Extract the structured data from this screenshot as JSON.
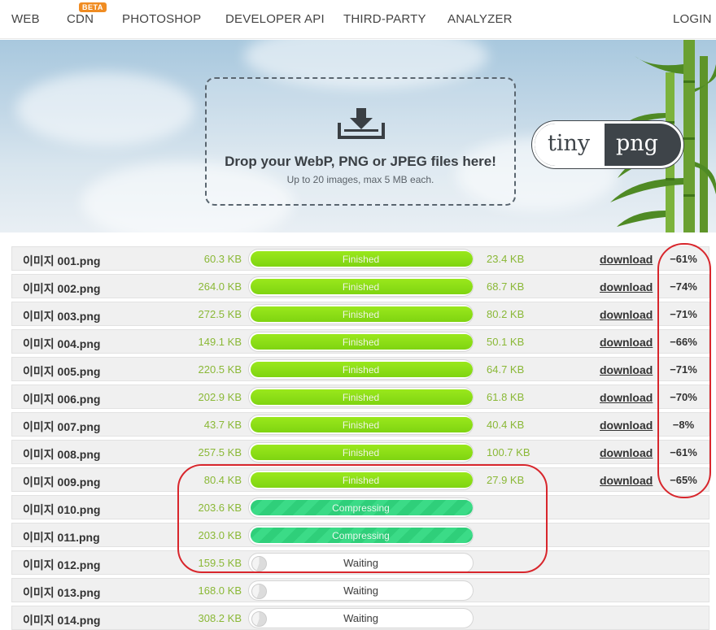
{
  "nav": {
    "items": [
      "WEB",
      "CDN",
      "PHOTOSHOP",
      "DEVELOPER API",
      "THIRD-PARTY",
      "ANALYZER"
    ],
    "beta_badge": "BETA",
    "login": "LOGIN"
  },
  "dropzone": {
    "title": "Drop your WebP, PNG or JPEG files here!",
    "subtitle": "Up to 20 images, max 5 MB each.",
    "icon": "download-tray-icon"
  },
  "logo": {
    "left": "tiny",
    "right": "png"
  },
  "colors": {
    "finished": "#8fdc17",
    "compressing": "#34d37f",
    "size_text": "#8ab836",
    "annotation": "#d8262c"
  },
  "files": [
    {
      "name": "이미지 001.png",
      "original": "60.3 KB",
      "status": "Finished",
      "new": "23.4 KB",
      "download": "download",
      "saving": "−61%"
    },
    {
      "name": "이미지 002.png",
      "original": "264.0 KB",
      "status": "Finished",
      "new": "68.7 KB",
      "download": "download",
      "saving": "−74%"
    },
    {
      "name": "이미지 003.png",
      "original": "272.5 KB",
      "status": "Finished",
      "new": "80.2 KB",
      "download": "download",
      "saving": "−71%"
    },
    {
      "name": "이미지 004.png",
      "original": "149.1 KB",
      "status": "Finished",
      "new": "50.1 KB",
      "download": "download",
      "saving": "−66%"
    },
    {
      "name": "이미지 005.png",
      "original": "220.5 KB",
      "status": "Finished",
      "new": "64.7 KB",
      "download": "download",
      "saving": "−71%"
    },
    {
      "name": "이미지 006.png",
      "original": "202.9 KB",
      "status": "Finished",
      "new": "61.8 KB",
      "download": "download",
      "saving": "−70%"
    },
    {
      "name": "이미지 007.png",
      "original": "43.7 KB",
      "status": "Finished",
      "new": "40.4 KB",
      "download": "download",
      "saving": "−8%"
    },
    {
      "name": "이미지 008.png",
      "original": "257.5 KB",
      "status": "Finished",
      "new": "100.7 KB",
      "download": "download",
      "saving": "−61%"
    },
    {
      "name": "이미지 009.png",
      "original": "80.4 KB",
      "status": "Finished",
      "new": "27.9 KB",
      "download": "download",
      "saving": "−65%"
    },
    {
      "name": "이미지 010.png",
      "original": "203.6 KB",
      "status": "Compressing",
      "new": "",
      "download": "",
      "saving": ""
    },
    {
      "name": "이미지 011.png",
      "original": "203.0 KB",
      "status": "Compressing",
      "new": "",
      "download": "",
      "saving": ""
    },
    {
      "name": "이미지 012.png",
      "original": "159.5 KB",
      "status": "Waiting",
      "new": "",
      "download": "",
      "saving": ""
    },
    {
      "name": "이미지 013.png",
      "original": "168.0 KB",
      "status": "Waiting",
      "new": "",
      "download": "",
      "saving": ""
    },
    {
      "name": "이미지 014.png",
      "original": "308.2 KB",
      "status": "Waiting",
      "new": "",
      "download": "",
      "saving": ""
    }
  ]
}
